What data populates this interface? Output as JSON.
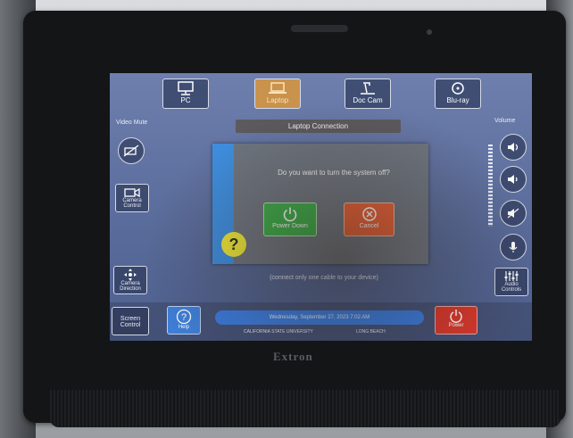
{
  "brand": "Extron",
  "sources": [
    {
      "label": "PC",
      "icon": "monitor-icon"
    },
    {
      "label": "Laptop",
      "icon": "laptop-icon"
    },
    {
      "label": "Doc Cam",
      "icon": "document-camera-icon"
    },
    {
      "label": "Blu-ray",
      "icon": "disc-icon"
    }
  ],
  "left_panel": {
    "video_mute_label": "Video Mute",
    "camera_control_label": "Camera Control",
    "camera_direction_label": "Camera Direction",
    "screen_control_label": "Screen Control"
  },
  "main": {
    "title": "Laptop Connection",
    "hint": "(connect only one cable to your device)"
  },
  "right_panel": {
    "volume_label": "Volume",
    "audio_controls_label": "Audio Controls"
  },
  "dialog": {
    "question": "Do you want to turn the system off?",
    "confirm_label": "Power Down",
    "cancel_label": "Cancel",
    "help_glyph": "?"
  },
  "bottom": {
    "help_label": "Help",
    "datetime": "Wednesday, September 27, 2023 7:02 AM",
    "university_left": "CALIFORNIA STATE UNIVERSITY",
    "university_right": "LONG BEACH",
    "power_label": "Power"
  },
  "colors": {
    "confirm": "#3fae4e",
    "cancel": "#e8623a",
    "power": "#d8382d",
    "accent": "#3b7ce0",
    "help_bubble": "#f0ea3b"
  }
}
